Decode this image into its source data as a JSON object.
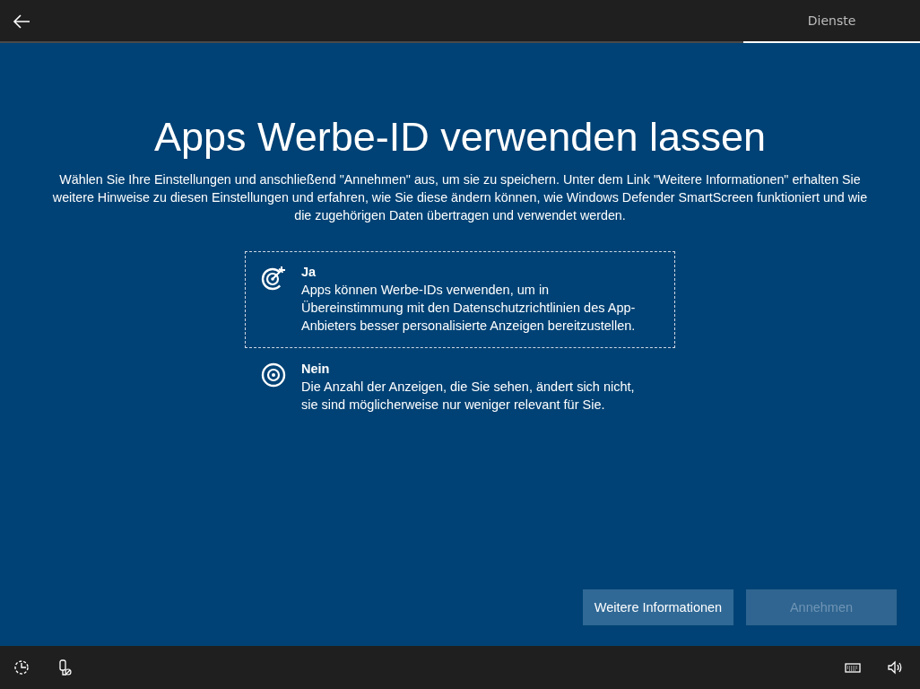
{
  "top_bar": {
    "tabs": [
      {
        "label": "Dienste",
        "selected": true
      }
    ]
  },
  "heading": "Apps Werbe-ID verwenden lassen",
  "description": "Wählen Sie Ihre Einstellungen und anschließend \"Annehmen\" aus, um sie zu speichern. Unter dem Link \"Weitere Informationen\" erhalten Sie weitere Hinweise zu diesen Einstellungen und erfahren, wie Sie diese ändern können, wie Windows Defender SmartScreen funktioniert und wie die zugehörigen Daten übertragen und verwendet werden.",
  "options": [
    {
      "kind": "target-arrow",
      "title": "Ja",
      "text": "Apps können Werbe-IDs verwenden, um in Übereinstimmung mit den Datenschutzrichtlinien des App-Anbieters besser personalisierte Anzeigen bereitzustellen.",
      "selected": true
    },
    {
      "kind": "target",
      "title": "Nein",
      "text": "Die Anzahl der Anzeigen, die Sie sehen, ändert sich nicht, sie sind möglicherweise nur weniger relevant für Sie.",
      "selected": false
    }
  ],
  "buttons": [
    {
      "label": "Weitere Informationen",
      "disabled": false
    },
    {
      "label": "Annehmen",
      "disabled": true
    }
  ]
}
